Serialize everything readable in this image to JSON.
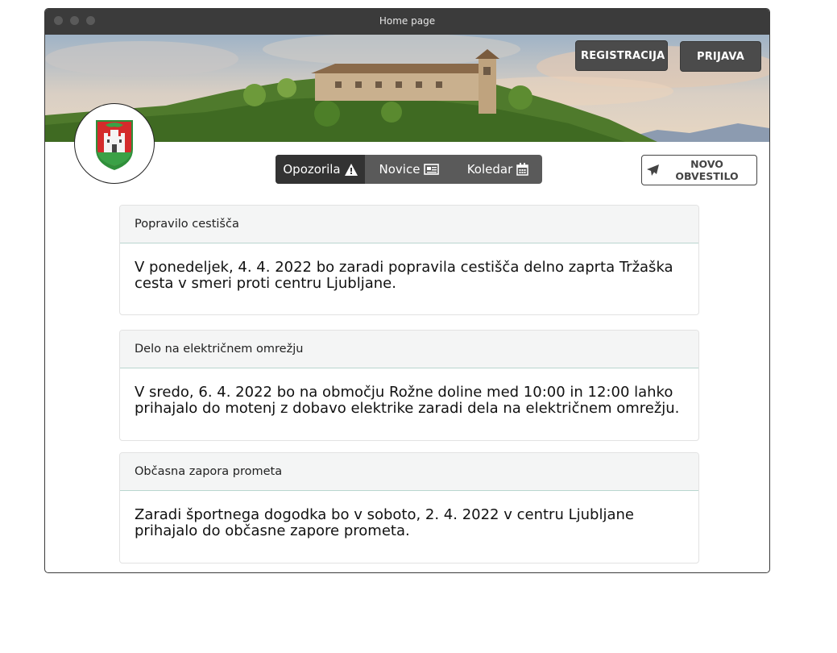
{
  "window": {
    "title": "Home page"
  },
  "auth": {
    "register_label": "REGISTRACIJA",
    "login_label": "PRIJAVA"
  },
  "tabs": [
    {
      "label": "Opozorila",
      "icon": "warning-icon",
      "active": true
    },
    {
      "label": "Novice",
      "icon": "newspaper-icon",
      "active": false
    },
    {
      "label": "Koledar",
      "icon": "calendar-icon",
      "active": false
    }
  ],
  "new_notice": {
    "label": "NOVO OBVESTILO",
    "icon": "paper-plane-icon"
  },
  "notices": [
    {
      "title": "Popravilo cestišča",
      "body": "V ponedeljek, 4. 4. 2022 bo zaradi popravila cestišča delno zaprta Tržaška cesta v smeri proti centru Ljubljane."
    },
    {
      "title": "Delo na električnem omrežju",
      "body": "V sredo, 6. 4. 2022 bo na območju Rožne doline med 10:00 in 12:00 lahko prihajalo do motenj z dobavo elektrike zaradi dela na električnem omrežju."
    },
    {
      "title": "Občasna zapora prometa",
      "body": "Zaradi športnega dogodka bo v soboto, 2. 4. 2022 v centru Ljubljane prihajalo do občasne zapore prometa."
    }
  ],
  "colors": {
    "tab_active": "#333333",
    "tab_bg": "#5a5a5a",
    "button_dark": "#4b4b4b",
    "card_header": "#f4f5f5"
  }
}
